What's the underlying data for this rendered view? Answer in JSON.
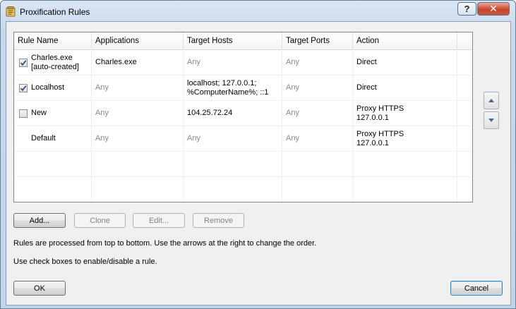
{
  "window": {
    "title": "Proxification Rules",
    "help_label": "?",
    "close_label": "✕"
  },
  "grid": {
    "columns": [
      "Rule Name",
      "Applications",
      "Target Hosts",
      "Target Ports",
      "Action"
    ],
    "rows": [
      {
        "checked": true,
        "has_checkbox": true,
        "name": [
          "Charles.exe",
          "[auto-created]"
        ],
        "applications": "Charles.exe",
        "hosts": "Any",
        "hosts2": "",
        "ports": "Any",
        "action": "Direct",
        "action2": ""
      },
      {
        "checked": true,
        "has_checkbox": true,
        "name": [
          "Localhost",
          ""
        ],
        "applications": "Any",
        "hosts": "localhost; 127.0.0.1;",
        "hosts2": "%ComputerName%; ::1",
        "ports": "Any",
        "action": "Direct",
        "action2": ""
      },
      {
        "checked": false,
        "has_checkbox": true,
        "name": [
          "New",
          ""
        ],
        "applications": "Any",
        "hosts": "104.25.72.24",
        "hosts2": "",
        "ports": "Any",
        "action": "Proxy HTTPS",
        "action2": "127.0.0.1"
      },
      {
        "checked": false,
        "has_checkbox": false,
        "name": [
          "Default",
          ""
        ],
        "applications": "Any",
        "hosts": "Any",
        "hosts2": "",
        "ports": "Any",
        "action": "Proxy HTTPS",
        "action2": "127.0.0.1"
      }
    ]
  },
  "buttons": {
    "add": "Add...",
    "clone": "Clone",
    "edit": "Edit...",
    "remove": "Remove",
    "ok": "OK",
    "cancel": "Cancel"
  },
  "info": {
    "line1": "Rules are processed from top to bottom. Use the arrows at the right to change the order.",
    "line2": "Use check boxes to enable/disable a rule."
  },
  "icons": {
    "title": "proxifier-icon",
    "up": "arrow-up-icon",
    "down": "arrow-down-icon",
    "check": "check-icon"
  }
}
